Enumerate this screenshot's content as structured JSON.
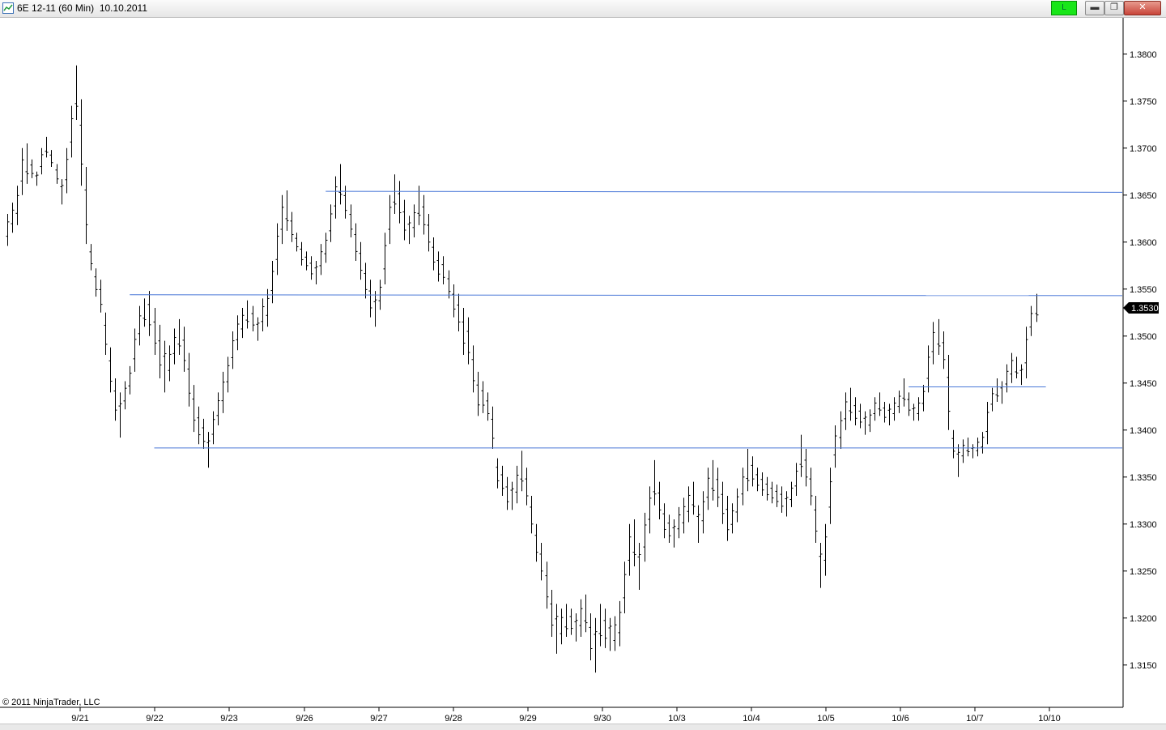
{
  "window": {
    "title": "6E 12-11 (60 Min)  10.10.2011",
    "badge_label": "L",
    "badge_color": "#19e619",
    "buttons": [
      {
        "icon": "minimize-icon",
        "glyph": "▬"
      },
      {
        "icon": "maximize-icon",
        "glyph": "❐"
      },
      {
        "icon": "close-icon",
        "glyph": "✕"
      }
    ]
  },
  "copyright": "© 2011 NinjaTrader, LLC",
  "chart_data": {
    "type": "ohlc",
    "instrument": "6E 12-11",
    "interval": "60 Min",
    "ylim": [
      1.3105,
      1.3835
    ],
    "y_ticks": [
      "1.3800",
      "1.3750",
      "1.3700",
      "1.3650",
      "1.3600",
      "1.3550",
      "1.3500",
      "1.3450",
      "1.3400",
      "1.3350",
      "1.3300",
      "1.3250",
      "1.3200",
      "1.3150"
    ],
    "x_ticks": [
      "9/21",
      "9/22",
      "9/23",
      "9/26",
      "9/27",
      "9/28",
      "9/29",
      "9/30",
      "10/3",
      "10/4",
      "10/5",
      "10/6",
      "10/7",
      "10/10"
    ],
    "last_price": "1.3530",
    "bar_color": "#000000",
    "line_color": "#4a78d8",
    "grid": false,
    "price_path": [
      [
        1.363,
        1.3596
      ],
      [
        1.3642,
        1.361
      ],
      [
        1.366,
        1.3618
      ],
      [
        1.37,
        1.365
      ],
      [
        1.3705,
        1.3662
      ],
      [
        1.3688,
        1.3668
      ],
      [
        1.3675,
        1.366
      ],
      [
        1.37,
        1.3672
      ],
      [
        1.3712,
        1.369
      ],
      [
        1.3698,
        1.368
      ],
      [
        1.3683,
        1.3662
      ],
      [
        1.3667,
        1.364
      ],
      [
        1.37,
        1.3652
      ],
      [
        1.3745,
        1.369
      ],
      [
        1.3788,
        1.373
      ],
      [
        1.3752,
        1.366
      ],
      [
        1.368,
        1.3598
      ],
      [
        1.3598,
        1.357
      ],
      [
        1.3572,
        1.3542
      ],
      [
        1.356,
        1.3525
      ],
      [
        1.3525,
        1.348
      ],
      [
        1.3488,
        1.344
      ],
      [
        1.3455,
        1.341
      ],
      [
        1.344,
        1.3392
      ],
      [
        1.3452,
        1.3422
      ],
      [
        1.3468,
        1.3438
      ],
      [
        1.3508,
        1.3462
      ],
      [
        1.3532,
        1.349
      ],
      [
        1.354,
        1.351
      ],
      [
        1.3548,
        1.35
      ],
      [
        1.353,
        1.348
      ],
      [
        1.3512,
        1.3455
      ],
      [
        1.3495,
        1.344
      ],
      [
        1.349,
        1.3452
      ],
      [
        1.3508,
        1.347
      ],
      [
        1.3518,
        1.348
      ],
      [
        1.351,
        1.3462
      ],
      [
        1.3482,
        1.3425
      ],
      [
        1.3448,
        1.3398
      ],
      [
        1.3425,
        1.3385
      ],
      [
        1.3412,
        1.338
      ],
      [
        1.3398,
        1.336
      ],
      [
        1.342,
        1.3385
      ],
      [
        1.344,
        1.3405
      ],
      [
        1.3462,
        1.3418
      ],
      [
        1.3478,
        1.344
      ],
      [
        1.3505,
        1.3465
      ],
      [
        1.3522,
        1.3485
      ],
      [
        1.353,
        1.3498
      ],
      [
        1.3538,
        1.3508
      ],
      [
        1.3532,
        1.3505
      ],
      [
        1.352,
        1.3495
      ],
      [
        1.354,
        1.3505
      ],
      [
        1.355,
        1.351
      ],
      [
        1.358,
        1.3535
      ],
      [
        1.362,
        1.3565
      ],
      [
        1.365,
        1.3598
      ],
      [
        1.3655,
        1.3612
      ],
      [
        1.3632,
        1.36
      ],
      [
        1.361,
        1.359
      ],
      [
        1.36,
        1.3575
      ],
      [
        1.359,
        1.357
      ],
      [
        1.3585,
        1.356
      ],
      [
        1.358,
        1.3555
      ],
      [
        1.3598,
        1.3565
      ],
      [
        1.361,
        1.3578
      ],
      [
        1.364,
        1.36
      ],
      [
        1.367,
        1.3625
      ],
      [
        1.3683,
        1.364
      ],
      [
        1.366,
        1.3625
      ],
      [
        1.364,
        1.3605
      ],
      [
        1.362,
        1.358
      ],
      [
        1.36,
        1.356
      ],
      [
        1.3578,
        1.354
      ],
      [
        1.356,
        1.352
      ],
      [
        1.3548,
        1.351
      ],
      [
        1.356,
        1.3528
      ],
      [
        1.361,
        1.3555
      ],
      [
        1.365,
        1.3598
      ],
      [
        1.3672,
        1.363
      ],
      [
        1.3665,
        1.362
      ],
      [
        1.3645,
        1.3602
      ],
      [
        1.3628,
        1.3598
      ],
      [
        1.364,
        1.3605
      ],
      [
        1.366,
        1.3618
      ],
      [
        1.365,
        1.3608
      ],
      [
        1.363,
        1.359
      ],
      [
        1.3605,
        1.357
      ],
      [
        1.359,
        1.3558
      ],
      [
        1.3585,
        1.3555
      ],
      [
        1.357,
        1.354
      ],
      [
        1.3555,
        1.352
      ],
      [
        1.3545,
        1.3505
      ],
      [
        1.353,
        1.348
      ],
      [
        1.352,
        1.347
      ],
      [
        1.349,
        1.344
      ],
      [
        1.3462,
        1.3415
      ],
      [
        1.3452,
        1.3418
      ],
      [
        1.344,
        1.341
      ],
      [
        1.3425,
        1.338
      ],
      [
        1.337,
        1.3338
      ],
      [
        1.3362,
        1.333
      ],
      [
        1.335,
        1.3315
      ],
      [
        1.3345,
        1.3315
      ],
      [
        1.3362,
        1.3322
      ],
      [
        1.3378,
        1.3335
      ],
      [
        1.336,
        1.332
      ],
      [
        1.333,
        1.329
      ],
      [
        1.33,
        1.326
      ],
      [
        1.328,
        1.324
      ],
      [
        1.326,
        1.321
      ],
      [
        1.323,
        1.318
      ],
      [
        1.3215,
        1.3162
      ],
      [
        1.321,
        1.3172
      ],
      [
        1.3215,
        1.318
      ],
      [
        1.321,
        1.3182
      ],
      [
        1.3205,
        1.3175
      ],
      [
        1.322,
        1.318
      ],
      [
        1.3225,
        1.3185
      ],
      [
        1.3205,
        1.3155
      ],
      [
        1.32,
        1.3142
      ],
      [
        1.3215,
        1.317
      ],
      [
        1.321,
        1.3168
      ],
      [
        1.32,
        1.3165
      ],
      [
        1.3202,
        1.3165
      ],
      [
        1.3218,
        1.317
      ],
      [
        1.326,
        1.3205
      ],
      [
        1.33,
        1.3245
      ],
      [
        1.3305,
        1.3255
      ],
      [
        1.328,
        1.323
      ],
      [
        1.3312,
        1.326
      ],
      [
        1.334,
        1.329
      ],
      [
        1.3368,
        1.332
      ],
      [
        1.3345,
        1.3305
      ],
      [
        1.3322,
        1.3285
      ],
      [
        1.331,
        1.328
      ],
      [
        1.3305,
        1.3275
      ],
      [
        1.3318,
        1.3285
      ],
      [
        1.3328,
        1.329
      ],
      [
        1.334,
        1.3302
      ],
      [
        1.3345,
        1.331
      ],
      [
        1.332,
        1.328
      ],
      [
        1.3335,
        1.329
      ],
      [
        1.336,
        1.3315
      ],
      [
        1.3368,
        1.3325
      ],
      [
        1.336,
        1.3318
      ],
      [
        1.3345,
        1.33
      ],
      [
        1.333,
        1.3282
      ],
      [
        1.3322,
        1.329
      ],
      [
        1.3338,
        1.3302
      ],
      [
        1.336,
        1.332
      ],
      [
        1.338,
        1.3335
      ],
      [
        1.3372,
        1.334
      ],
      [
        1.336,
        1.3335
      ],
      [
        1.3355,
        1.333
      ],
      [
        1.335,
        1.3325
      ],
      [
        1.3345,
        1.3322
      ],
      [
        1.3342,
        1.3318
      ],
      [
        1.334,
        1.3312
      ],
      [
        1.3335,
        1.3308
      ],
      [
        1.3345,
        1.3318
      ],
      [
        1.3365,
        1.333
      ],
      [
        1.3395,
        1.335
      ],
      [
        1.338,
        1.334
      ],
      [
        1.336,
        1.332
      ],
      [
        1.333,
        1.328
      ],
      [
        1.328,
        1.3232
      ],
      [
        1.33,
        1.3245
      ],
      [
        1.336,
        1.33
      ],
      [
        1.3405,
        1.336
      ],
      [
        1.342,
        1.338
      ],
      [
        1.344,
        1.34
      ],
      [
        1.3445,
        1.341
      ],
      [
        1.3435,
        1.3405
      ],
      [
        1.3428,
        1.3402
      ],
      [
        1.342,
        1.3395
      ],
      [
        1.3422,
        1.3398
      ],
      [
        1.3435,
        1.341
      ],
      [
        1.344,
        1.3415
      ],
      [
        1.343,
        1.3408
      ],
      [
        1.3428,
        1.3405
      ],
      [
        1.3435,
        1.341
      ],
      [
        1.3442,
        1.3418
      ],
      [
        1.3455,
        1.3425
      ],
      [
        1.344,
        1.3415
      ],
      [
        1.3428,
        1.341
      ],
      [
        1.3435,
        1.341
      ],
      [
        1.3448,
        1.342
      ],
      [
        1.349,
        1.344
      ],
      [
        1.3515,
        1.347
      ],
      [
        1.3518,
        1.348
      ],
      [
        1.3505,
        1.3465
      ],
      [
        1.348,
        1.34
      ],
      [
        1.34,
        1.337
      ],
      [
        1.3385,
        1.335
      ],
      [
        1.339,
        1.3365
      ],
      [
        1.3392,
        1.3372
      ],
      [
        1.3385,
        1.337
      ],
      [
        1.3392,
        1.3372
      ],
      [
        1.3398,
        1.3375
      ],
      [
        1.343,
        1.3385
      ],
      [
        1.3445,
        1.342
      ],
      [
        1.3455,
        1.343
      ],
      [
        1.3452,
        1.3428
      ],
      [
        1.347,
        1.344
      ],
      [
        1.3482,
        1.345
      ],
      [
        1.3478,
        1.3455
      ],
      [
        1.347,
        1.3448
      ],
      [
        1.351,
        1.3455
      ],
      [
        1.3532,
        1.35
      ],
      [
        1.3545,
        1.3515
      ]
    ],
    "horizontal_lines": [
      {
        "price": 1.3654,
        "from_bar": 65,
        "price_end": 1.3653
      },
      {
        "price": 1.3544,
        "from_bar": 25,
        "price_end": 1.3543
      },
      {
        "price": 1.3381,
        "from_bar": 30,
        "price_end": 1.3381
      },
      {
        "price": 1.3446,
        "from_bar": 184,
        "price_end": 1.3446,
        "to_bar": 212
      }
    ]
  }
}
